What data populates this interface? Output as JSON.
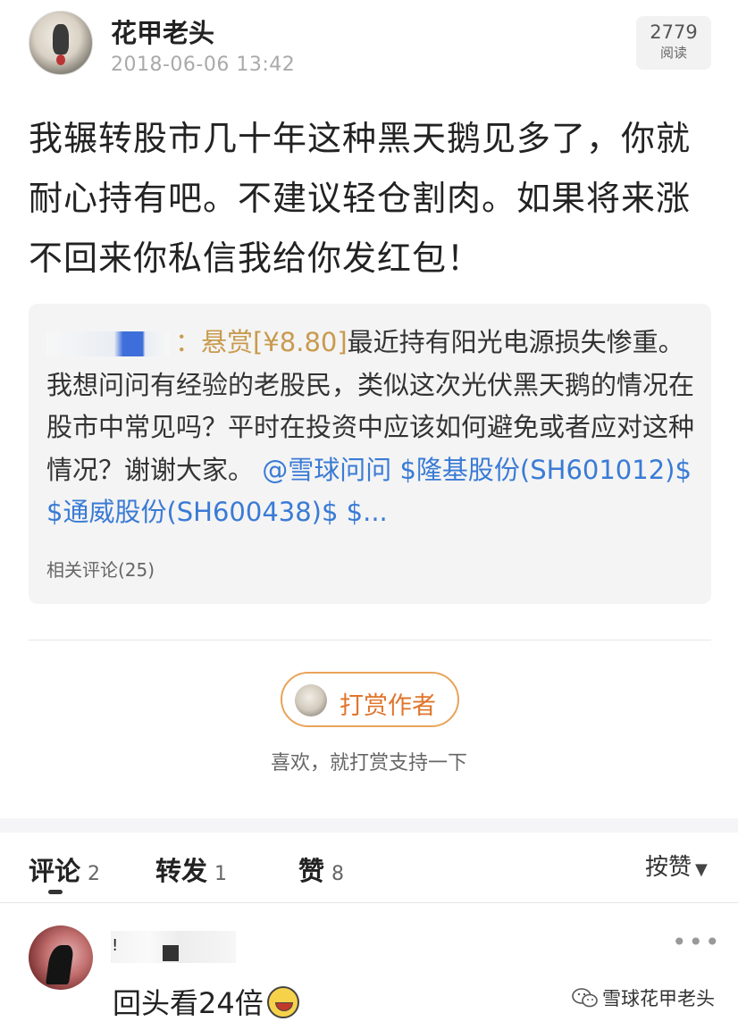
{
  "author": {
    "name": "花甲老头",
    "time": "2018-06-06 13:42",
    "read_count": "2779",
    "read_label": "阅读"
  },
  "post": {
    "text": "我辗转股市几十年这种黑天鹅见多了，你就耐心持有吧。不建议轻仓割肉。如果将来涨不回来你私信我给你发红包！"
  },
  "quote": {
    "separator": "：",
    "reward": "悬赏[¥8.80]",
    "body": "最近持有阳光电源损失惨重。我想问问有经验的老股民，类似这次光伏黑天鹅的情况在股市中常见吗？平时在投资中应该如何避免或者应对这种情况？谢谢大家。",
    "mention": "@雪球问问",
    "tags": "$隆基股份(SH601012)$ $通威股份(SH600438)$ $...",
    "related_comments": "相关评论(25)"
  },
  "reward": {
    "button_label": "打赏作者",
    "subtitle": "喜欢，就打赏支持一下"
  },
  "tabs": [
    {
      "label": "评论",
      "count": "2"
    },
    {
      "label": "转发",
      "count": "1"
    },
    {
      "label": "赞",
      "count": "8"
    }
  ],
  "sort_label": "按赞",
  "comment": {
    "more": "•••",
    "text": "回头看24倍"
  },
  "watermark": "雪球花甲老头",
  "colors": {
    "accent_gold": "#c99a4e",
    "link_blue": "#3a7bd5",
    "reward_orange": "#e0752b"
  }
}
